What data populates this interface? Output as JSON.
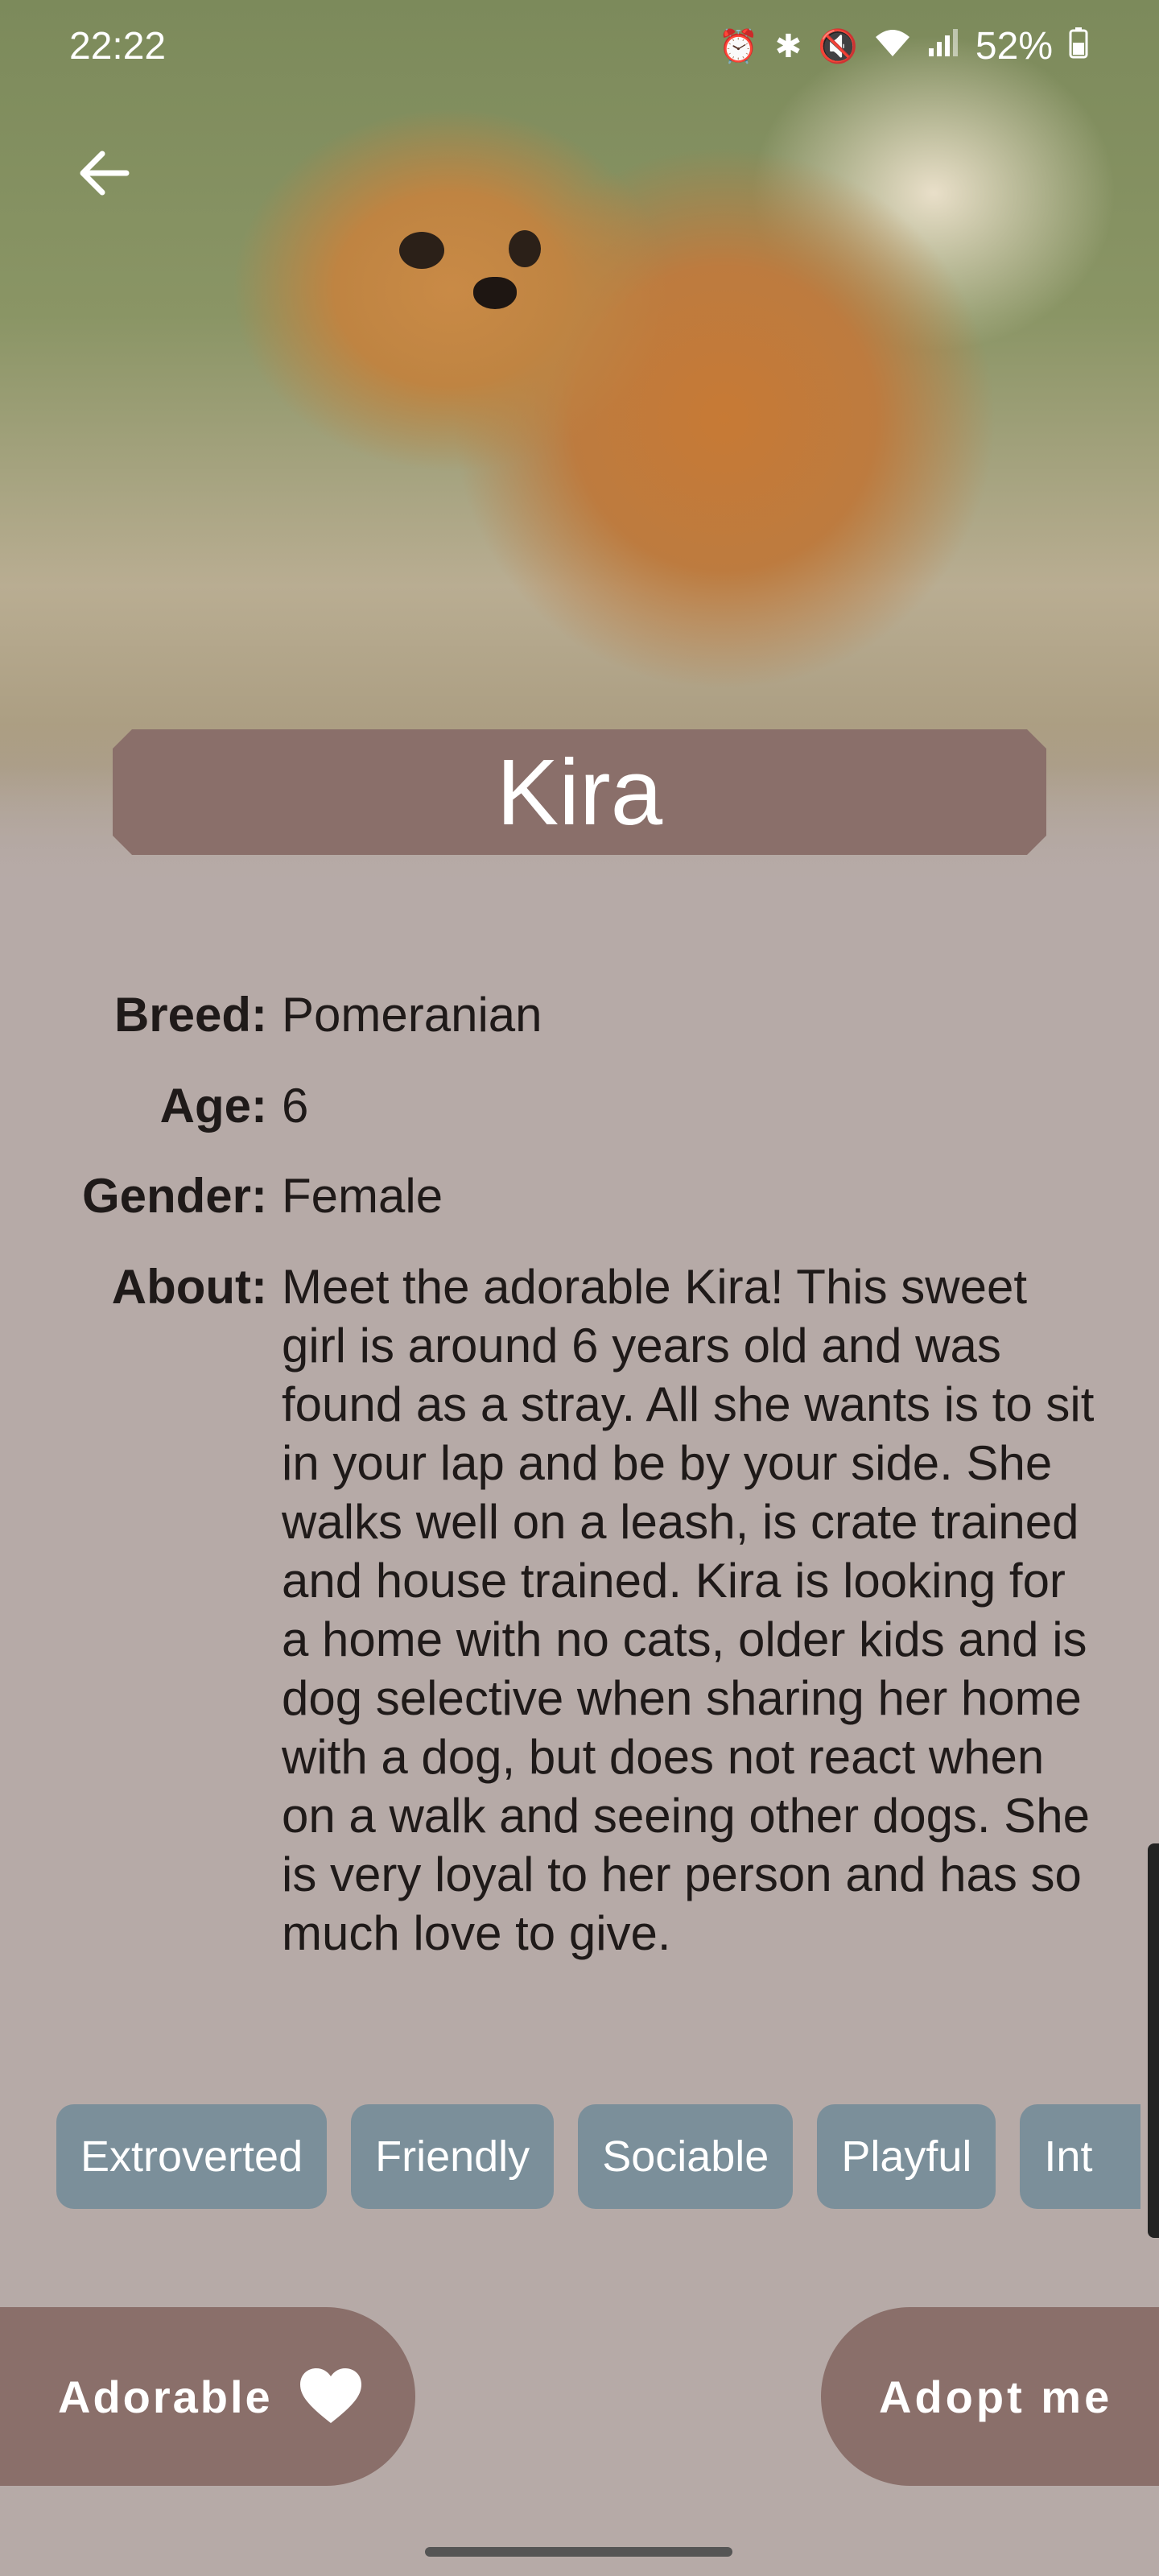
{
  "status_bar": {
    "time": "22:22",
    "battery": "52%",
    "icons": [
      "alarm-icon",
      "bluetooth-icon",
      "mute-icon",
      "wifi-icon",
      "volte-icon",
      "signal-icon",
      "battery-icon"
    ]
  },
  "pet": {
    "name": "Kira",
    "details": [
      {
        "label": "Breed:",
        "value": "Pomeranian"
      },
      {
        "label": "Age:",
        "value": "6"
      },
      {
        "label": "Gender:",
        "value": "Female"
      }
    ],
    "about_label": "About:",
    "about": "Meet the adorable Kira! This sweet girl is around 6 years old and was found as a stray. All she wants is to sit in your lap and be by your side. She walks well on a leash, is crate trained and house trained. Kira is looking for a home with no cats, older kids and is dog selective when sharing her home with a dog, but does not react when on a walk and seeing other dogs. She is very loyal to her person and has so much love to give."
  },
  "traits": [
    "Extroverted",
    "Friendly",
    "Sociable",
    "Playful",
    "Int"
  ],
  "actions": {
    "adorable": "Adorable",
    "adopt": "Adopt me"
  },
  "colors": {
    "background": "#b6aaa7",
    "accent": "#8a6f6a",
    "chip": "#7b8f9a"
  }
}
